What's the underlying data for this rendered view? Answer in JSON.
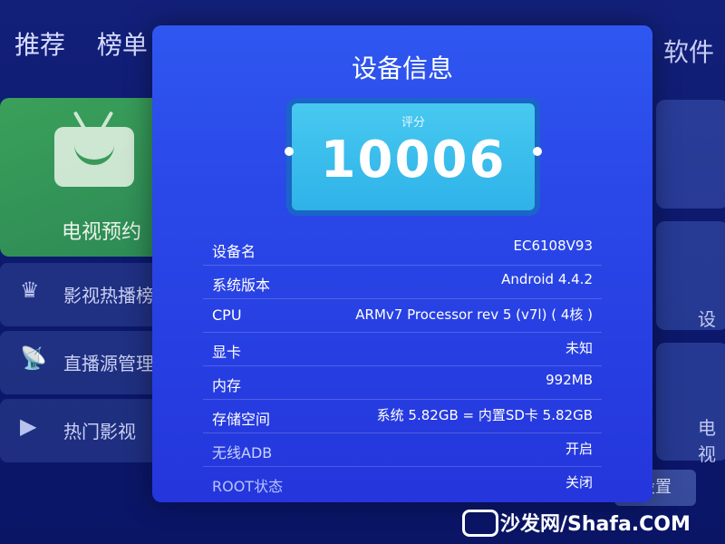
{
  "background": {
    "nav_left": [
      "推荐",
      "榜单"
    ],
    "nav_right": "软件",
    "tv_tile_label": "电视预约",
    "side_items": [
      {
        "icon": "crown-icon",
        "label": "影视热播榜"
      },
      {
        "icon": "satellite-dish-icon",
        "label": "直播源管理"
      },
      {
        "icon": "play-icon",
        "label": "热门影视"
      }
    ],
    "right_labels": [
      "设",
      "电视"
    ],
    "settings_button": "设置"
  },
  "dialog": {
    "title": "设备信息",
    "score_label": "评分",
    "score_value": "10006",
    "rows": [
      {
        "key": "设备名",
        "value": "EC6108V93"
      },
      {
        "key": "系统版本",
        "value": "Android 4.4.2"
      },
      {
        "key": "CPU",
        "value": "ARMv7 Processor rev 5 (v7l) ( 4核 )"
      },
      {
        "key": "显卡",
        "value": "未知"
      },
      {
        "key": "内存",
        "value": "992MB"
      },
      {
        "key": "存储空间",
        "value": "系统 5.82GB = 内置SD卡 5.82GB"
      },
      {
        "key": "无线ADB",
        "value": "开启"
      },
      {
        "key": "ROOT状态",
        "value": "关闭"
      }
    ]
  },
  "watermark": "沙发网/Shafa.COM",
  "colors": {
    "dialog_top": "#2f57f0",
    "dialog_bottom": "#2436dc",
    "score_bg": "#47c9f0",
    "tv_tile": "#3aa05a"
  }
}
